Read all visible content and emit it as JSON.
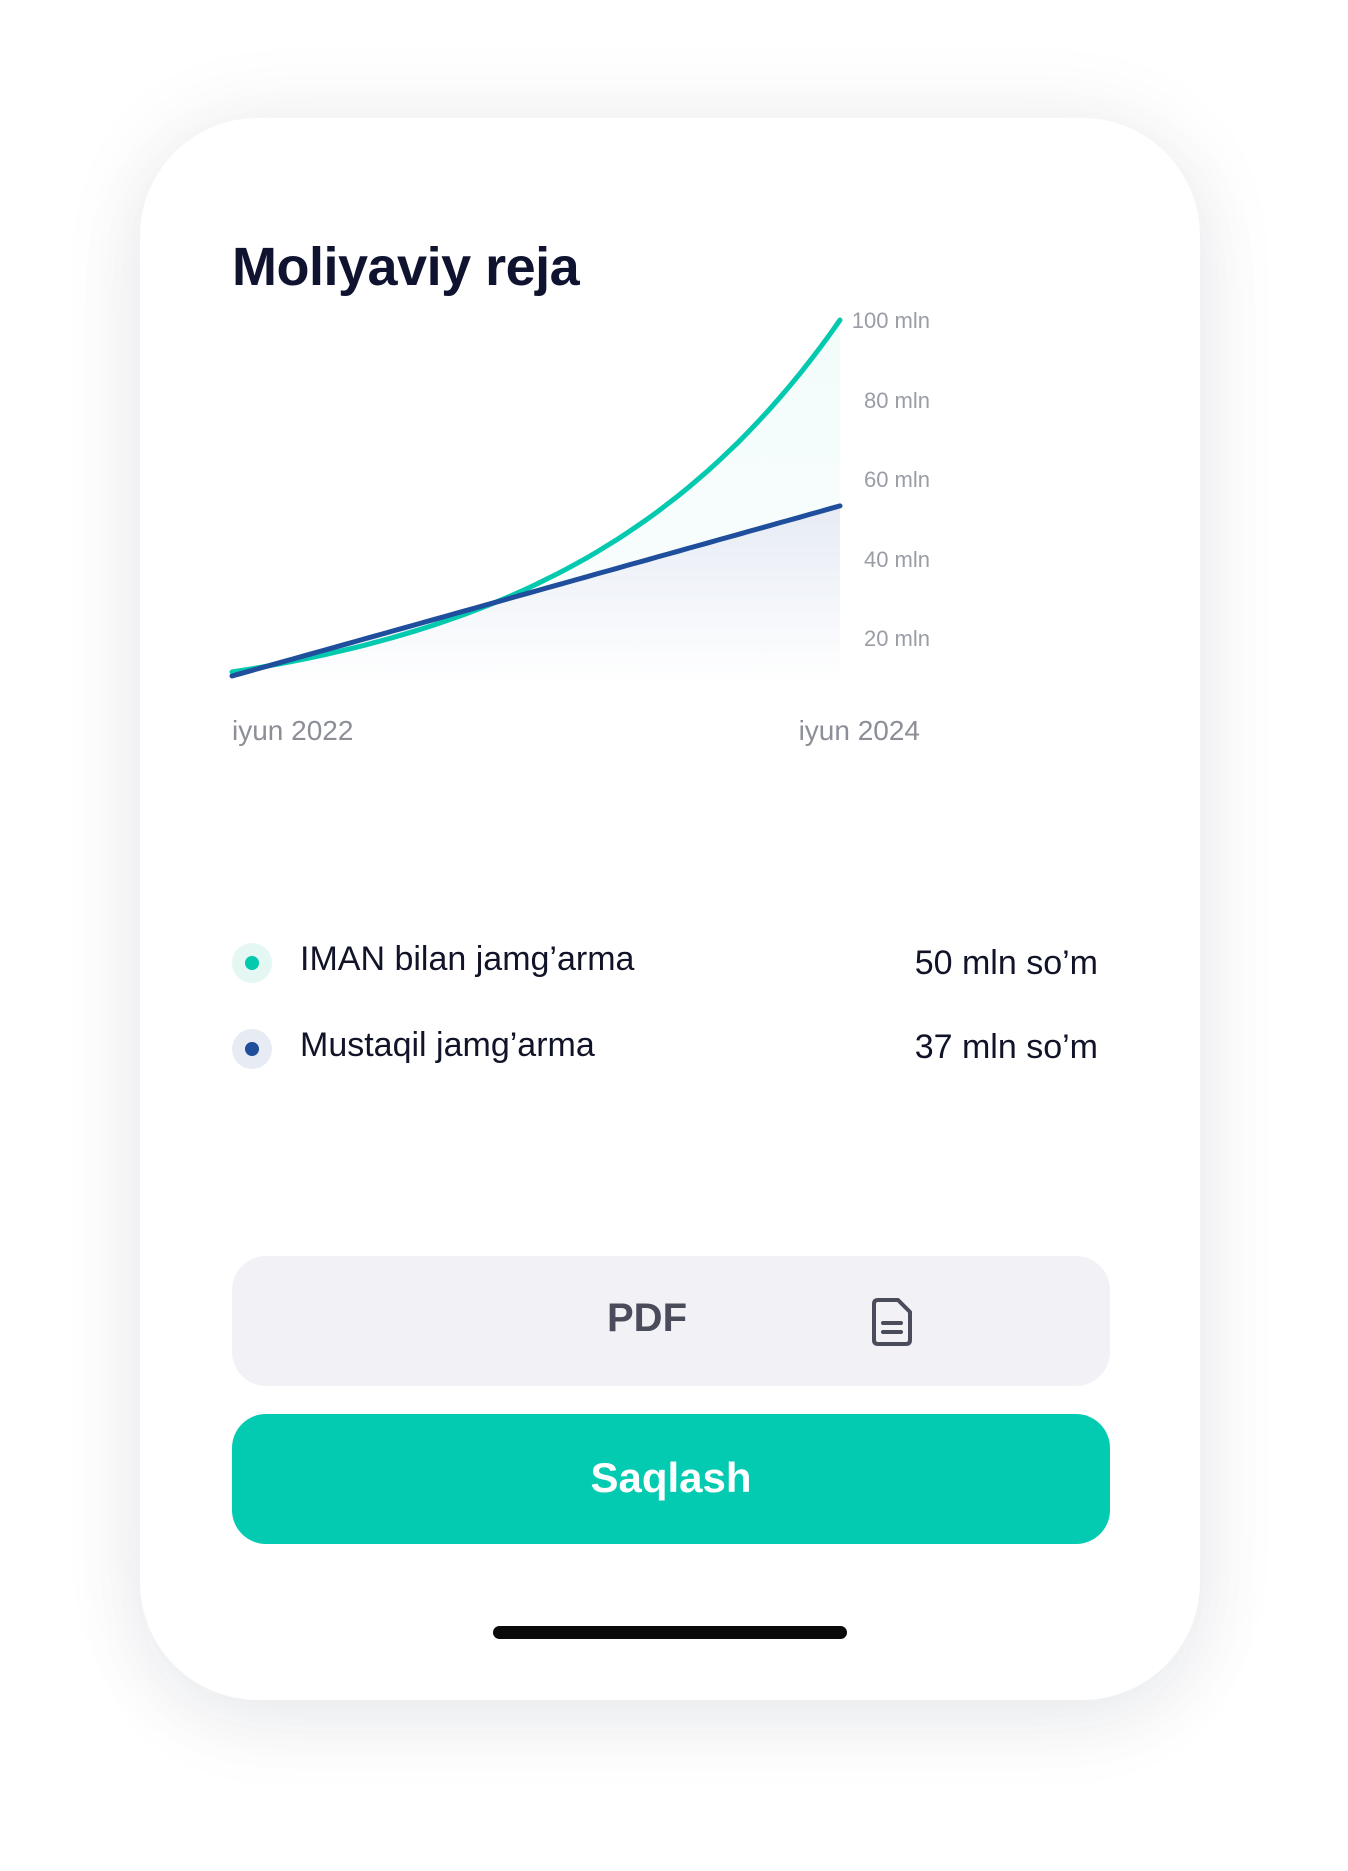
{
  "screen": {
    "title": "Moliyaviy reja"
  },
  "chart_data": {
    "type": "area",
    "x_labels": [
      "iyun 2022",
      "iyun 2024"
    ],
    "y_ticks": [
      "100 mln",
      "80 mln",
      "60 mln",
      "40 mln",
      "20 mln"
    ],
    "ylim": [
      10,
      100
    ],
    "series": [
      {
        "name": "IMAN bilan jamg’arma",
        "color": "#03c9ae",
        "curve": "exponential",
        "start": 11,
        "end": 100
      },
      {
        "name": "Mustaqil jamg’arma",
        "color": "#1f4e9c",
        "curve": "linear",
        "start": 10,
        "end": 53
      }
    ]
  },
  "legend": [
    {
      "label": "IMAN bilan jamg’arma",
      "value": "50 mln so’m",
      "dot_color": "#03c9ae",
      "halo_color": "#e5f7f3"
    },
    {
      "label": "Mustaqil jamg’arma",
      "value": "37 mln so’m",
      "dot_color": "#1f4e9c",
      "halo_color": "#e6ebf4"
    }
  ],
  "actions": {
    "pdf_label": "PDF",
    "pdf_icon": "document-icon",
    "save_label": "Saqlash"
  },
  "colors": {
    "accent": "#03cbb1",
    "secondary_button_bg": "#f2f2f6",
    "title_text": "#0f1330"
  }
}
